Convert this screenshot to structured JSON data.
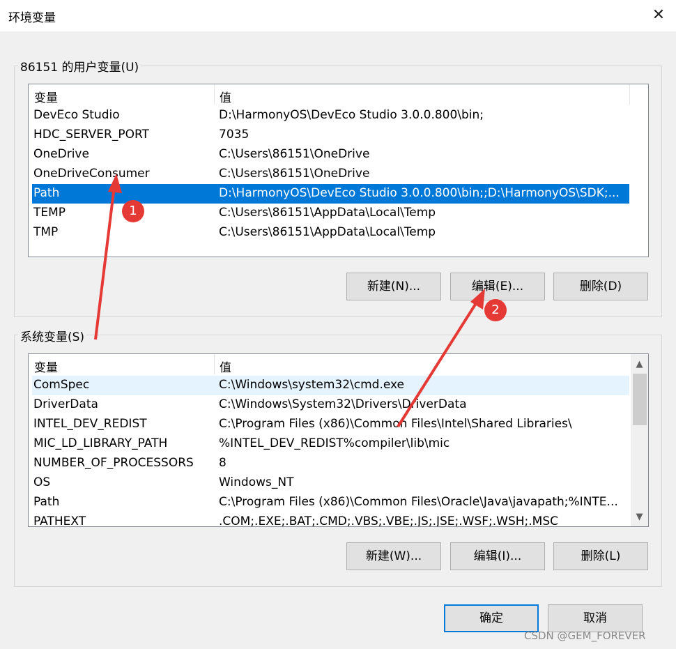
{
  "window": {
    "title": "环境变量",
    "close_icon": "close-icon"
  },
  "user_vars": {
    "group_label": "86151 的用户变量(U)",
    "columns": [
      "变量",
      "值"
    ],
    "rows": [
      {
        "name": "DevEco Studio",
        "value": "D:\\HarmonyOS\\DevEco Studio 3.0.0.800\\bin;"
      },
      {
        "name": "HDC_SERVER_PORT",
        "value": "7035"
      },
      {
        "name": "OneDrive",
        "value": "C:\\Users\\86151\\OneDrive"
      },
      {
        "name": "OneDriveConsumer",
        "value": "C:\\Users\\86151\\OneDrive"
      },
      {
        "name": "Path",
        "value": "D:\\HarmonyOS\\DevEco Studio 3.0.0.800\\bin;;D:\\HarmonyOS\\SDK;..."
      },
      {
        "name": "TEMP",
        "value": "C:\\Users\\86151\\AppData\\Local\\Temp"
      },
      {
        "name": "TMP",
        "value": "C:\\Users\\86151\\AppData\\Local\\Temp"
      }
    ],
    "selected_index": 4,
    "buttons": {
      "new": "新建(N)...",
      "edit": "编辑(E)...",
      "delete": "删除(D)"
    }
  },
  "system_vars": {
    "group_label": "系统变量(S)",
    "columns": [
      "变量",
      "值"
    ],
    "rows": [
      {
        "name": "ComSpec",
        "value": "C:\\Windows\\system32\\cmd.exe"
      },
      {
        "name": "DriverData",
        "value": "C:\\Windows\\System32\\Drivers\\DriverData"
      },
      {
        "name": "INTEL_DEV_REDIST",
        "value": "C:\\Program Files (x86)\\Common Files\\Intel\\Shared Libraries\\"
      },
      {
        "name": "MIC_LD_LIBRARY_PATH",
        "value": "%INTEL_DEV_REDIST%compiler\\lib\\mic"
      },
      {
        "name": "NUMBER_OF_PROCESSORS",
        "value": "8"
      },
      {
        "name": "OS",
        "value": "Windows_NT"
      },
      {
        "name": "Path",
        "value": "C:\\Program Files (x86)\\Common Files\\Oracle\\Java\\javapath;%INTE..."
      },
      {
        "name": "PATHEXT",
        "value": ".COM;.EXE;.BAT;.CMD;.VBS;.VBE;.JS;.JSE;.WSF;.WSH;.MSC"
      }
    ],
    "hover_index": 0,
    "buttons": {
      "new": "新建(W)...",
      "edit": "编辑(I)...",
      "delete": "删除(L)"
    }
  },
  "footer": {
    "ok": "确定",
    "cancel": "取消"
  },
  "annotations": {
    "badge1": "1",
    "badge2": "2",
    "color": "#e53935"
  },
  "watermark": "CSDN @GEM_FOREVER"
}
